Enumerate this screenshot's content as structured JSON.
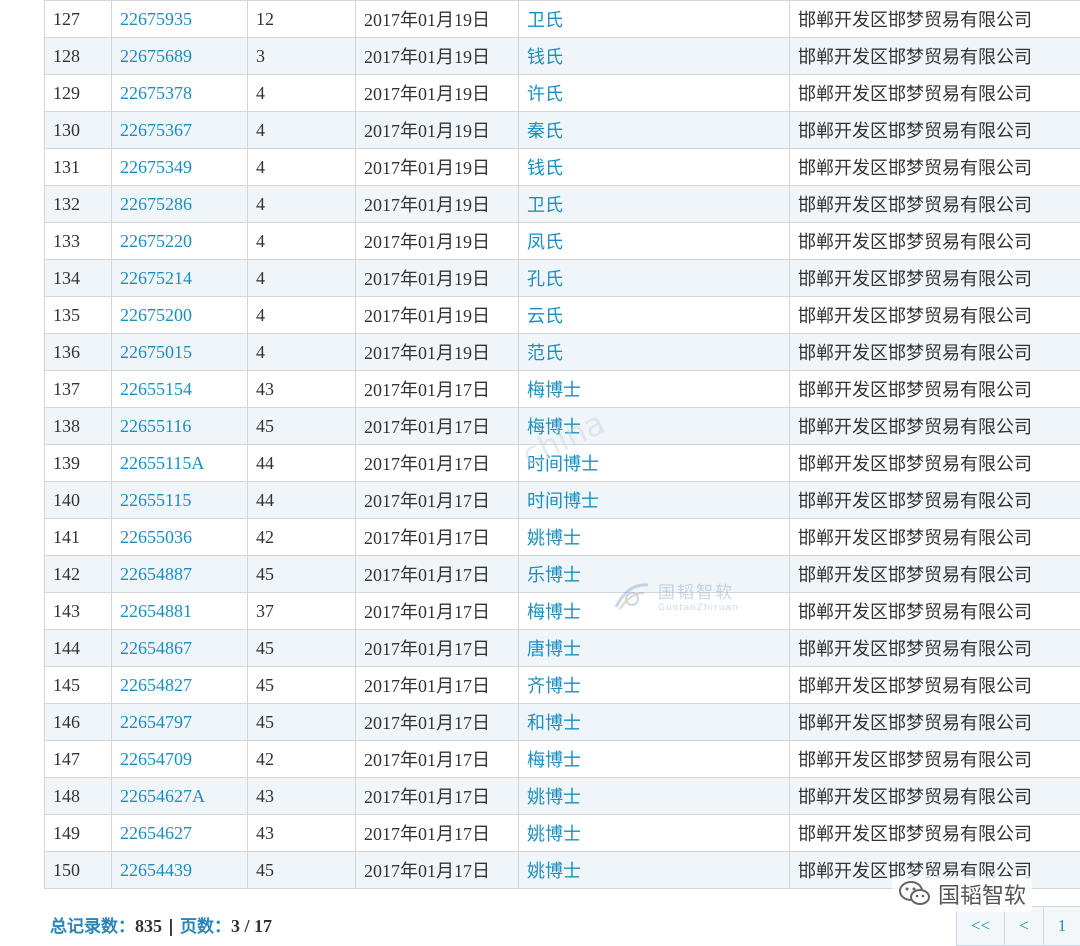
{
  "rows": [
    {
      "no": "127",
      "reg": "22675935",
      "cls": "12",
      "date": "2017年01月19日",
      "name": "卫氏",
      "owner": "邯郸开发区邯梦贸易有限公司"
    },
    {
      "no": "128",
      "reg": "22675689",
      "cls": "3",
      "date": "2017年01月19日",
      "name": "钱氏",
      "owner": "邯郸开发区邯梦贸易有限公司"
    },
    {
      "no": "129",
      "reg": "22675378",
      "cls": "4",
      "date": "2017年01月19日",
      "name": "许氏",
      "owner": "邯郸开发区邯梦贸易有限公司"
    },
    {
      "no": "130",
      "reg": "22675367",
      "cls": "4",
      "date": "2017年01月19日",
      "name": "秦氏",
      "owner": "邯郸开发区邯梦贸易有限公司"
    },
    {
      "no": "131",
      "reg": "22675349",
      "cls": "4",
      "date": "2017年01月19日",
      "name": "钱氏",
      "owner": "邯郸开发区邯梦贸易有限公司"
    },
    {
      "no": "132",
      "reg": "22675286",
      "cls": "4",
      "date": "2017年01月19日",
      "name": "卫氏",
      "owner": "邯郸开发区邯梦贸易有限公司"
    },
    {
      "no": "133",
      "reg": "22675220",
      "cls": "4",
      "date": "2017年01月19日",
      "name": "凤氏",
      "owner": "邯郸开发区邯梦贸易有限公司"
    },
    {
      "no": "134",
      "reg": "22675214",
      "cls": "4",
      "date": "2017年01月19日",
      "name": "孔氏",
      "owner": "邯郸开发区邯梦贸易有限公司"
    },
    {
      "no": "135",
      "reg": "22675200",
      "cls": "4",
      "date": "2017年01月19日",
      "name": "云氏",
      "owner": "邯郸开发区邯梦贸易有限公司"
    },
    {
      "no": "136",
      "reg": "22675015",
      "cls": "4",
      "date": "2017年01月19日",
      "name": "范氏",
      "owner": "邯郸开发区邯梦贸易有限公司"
    },
    {
      "no": "137",
      "reg": "22655154",
      "cls": "43",
      "date": "2017年01月17日",
      "name": "梅博士",
      "owner": "邯郸开发区邯梦贸易有限公司"
    },
    {
      "no": "138",
      "reg": "22655116",
      "cls": "45",
      "date": "2017年01月17日",
      "name": "梅博士",
      "owner": "邯郸开发区邯梦贸易有限公司"
    },
    {
      "no": "139",
      "reg": "22655115A",
      "cls": "44",
      "date": "2017年01月17日",
      "name": "时间博士",
      "owner": "邯郸开发区邯梦贸易有限公司"
    },
    {
      "no": "140",
      "reg": "22655115",
      "cls": "44",
      "date": "2017年01月17日",
      "name": "时间博士",
      "owner": "邯郸开发区邯梦贸易有限公司"
    },
    {
      "no": "141",
      "reg": "22655036",
      "cls": "42",
      "date": "2017年01月17日",
      "name": "姚博士",
      "owner": "邯郸开发区邯梦贸易有限公司"
    },
    {
      "no": "142",
      "reg": "22654887",
      "cls": "45",
      "date": "2017年01月17日",
      "name": "乐博士",
      "owner": "邯郸开发区邯梦贸易有限公司"
    },
    {
      "no": "143",
      "reg": "22654881",
      "cls": "37",
      "date": "2017年01月17日",
      "name": "梅博士",
      "owner": "邯郸开发区邯梦贸易有限公司"
    },
    {
      "no": "144",
      "reg": "22654867",
      "cls": "45",
      "date": "2017年01月17日",
      "name": "唐博士",
      "owner": "邯郸开发区邯梦贸易有限公司"
    },
    {
      "no": "145",
      "reg": "22654827",
      "cls": "45",
      "date": "2017年01月17日",
      "name": "齐博士",
      "owner": "邯郸开发区邯梦贸易有限公司"
    },
    {
      "no": "146",
      "reg": "22654797",
      "cls": "45",
      "date": "2017年01月17日",
      "name": "和博士",
      "owner": "邯郸开发区邯梦贸易有限公司"
    },
    {
      "no": "147",
      "reg": "22654709",
      "cls": "42",
      "date": "2017年01月17日",
      "name": "梅博士",
      "owner": "邯郸开发区邯梦贸易有限公司"
    },
    {
      "no": "148",
      "reg": "22654627A",
      "cls": "43",
      "date": "2017年01月17日",
      "name": "姚博士",
      "owner": "邯郸开发区邯梦贸易有限公司"
    },
    {
      "no": "149",
      "reg": "22654627",
      "cls": "43",
      "date": "2017年01月17日",
      "name": "姚博士",
      "owner": "邯郸开发区邯梦贸易有限公司"
    },
    {
      "no": "150",
      "reg": "22654439",
      "cls": "45",
      "date": "2017年01月17日",
      "name": "姚博士",
      "owner": "邯郸开发区邯梦贸易有限公司"
    }
  ],
  "footer": {
    "total_label": "总记录数：",
    "total_value": "835",
    "sep": " | ",
    "pages_label": "页数：",
    "pages_value": "3 / 17"
  },
  "pager": {
    "first": "<<",
    "prev": "<",
    "page1": "1"
  },
  "watermarks": {
    "diagonal": "china",
    "center_cn": "国韬智软",
    "center_en": "GuotaoZhiruan",
    "corner": "国韬智软"
  },
  "colors": {
    "link": "#1a8fc0",
    "row_alt": "#f0f5fa",
    "border": "#d6d6d6"
  }
}
